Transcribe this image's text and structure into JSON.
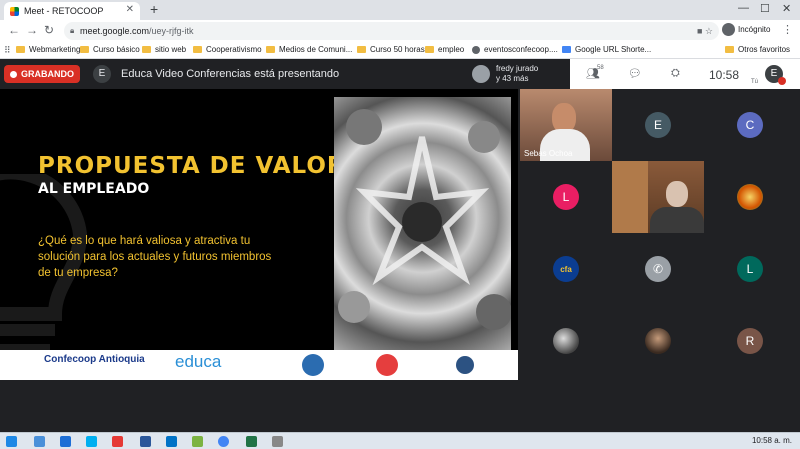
{
  "browser": {
    "tab_title": "Meet - RETOCOOP",
    "url_host": "meet.google.com",
    "url_path": "/uey-rjfg-itk",
    "incognito_label": "Incógnito",
    "bookmarks": [
      {
        "label": "Webmarketing",
        "icon": "folder-icon"
      },
      {
        "label": "Curso básico",
        "icon": "folder-icon"
      },
      {
        "label": "sitio web",
        "icon": "folder-icon"
      },
      {
        "label": "Cooperativismo",
        "icon": "folder-icon"
      },
      {
        "label": "Medios de Comuni...",
        "icon": "folder-icon"
      },
      {
        "label": "Curso 50 horas",
        "icon": "folder-icon"
      },
      {
        "label": "empleo",
        "icon": "folder-icon"
      },
      {
        "label": "eventosconfecoop....",
        "icon": "globe-icon"
      },
      {
        "label": "Google URL Shorte...",
        "icon": "shortener-icon"
      }
    ],
    "other_bookmarks": "Otros favoritos"
  },
  "meet": {
    "recording_label": "GRABANDO",
    "presenter_initial": "E",
    "presenting_text": "Educa Video Conferencias está presentando",
    "others_name": "fredy jurado",
    "others_more": "y 43 más",
    "participant_count": "58",
    "time": "10:58",
    "me_initial": "E",
    "me_label": "Tú"
  },
  "slide": {
    "title_line1": "PROPUESTA DE VALOR",
    "title_line2": "AL EMPLEADO",
    "question": "¿Qué es lo que hará valiosa y atractiva tu solución para los actuales y futuros miembros de tu empresa?",
    "logos": [
      "Confecoop Antioquia",
      "educa",
      "",
      "",
      ""
    ],
    "accent_color": "#f2c230"
  },
  "tiles": [
    {
      "type": "video",
      "label": "Sebas Ochoa"
    },
    {
      "type": "initial",
      "initial": "E",
      "color": "#455a64"
    },
    {
      "type": "initial",
      "initial": "C",
      "color": "#5c6bc0"
    },
    {
      "type": "initial",
      "initial": "L",
      "color": "#e91e63"
    },
    {
      "type": "video",
      "label": ""
    },
    {
      "type": "image",
      "label": ""
    },
    {
      "type": "image",
      "label": ""
    },
    {
      "type": "icon",
      "icon": "phone-icon",
      "color": "#9aa0a6"
    },
    {
      "type": "initial",
      "initial": "L",
      "color": "#00695c"
    },
    {
      "type": "image",
      "label": ""
    },
    {
      "type": "image",
      "label": ""
    },
    {
      "type": "initial",
      "initial": "R",
      "color": "#795548"
    }
  ],
  "taskbar": {
    "time": "10:58 a. m."
  }
}
